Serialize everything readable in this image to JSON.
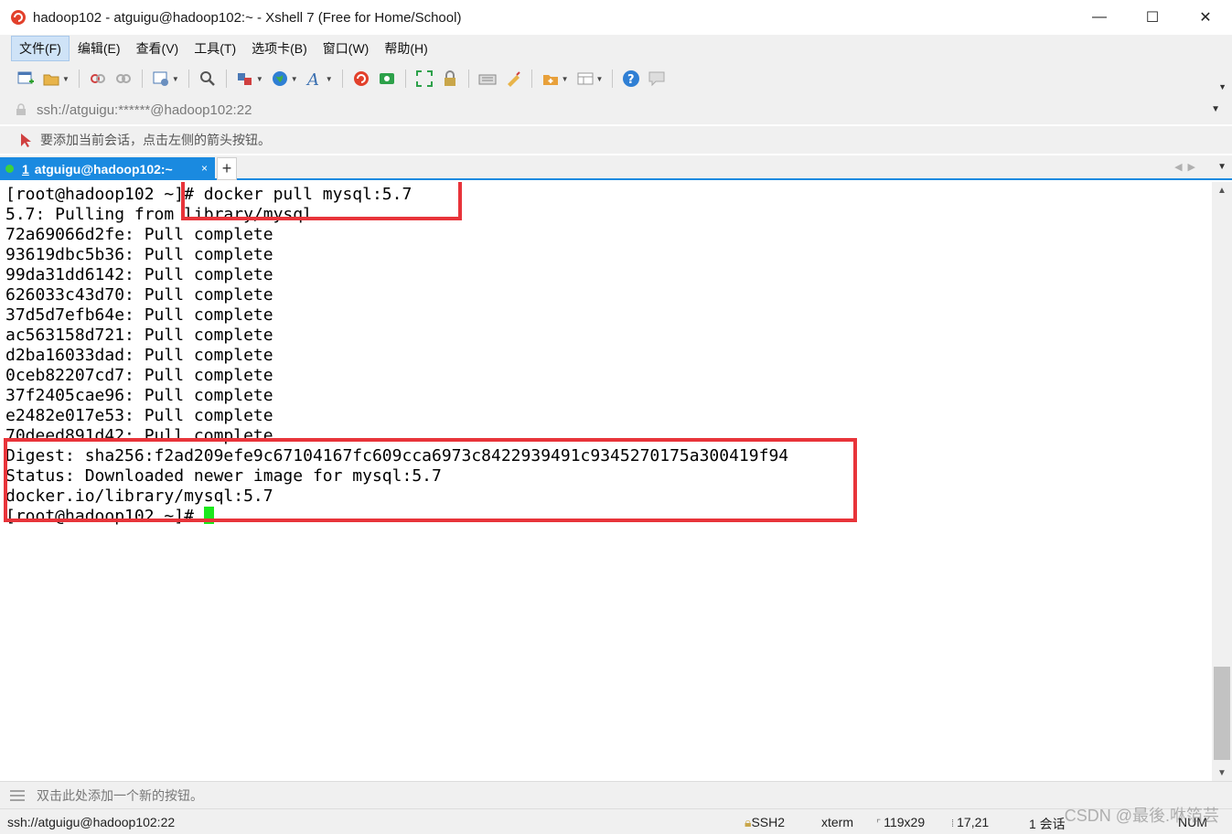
{
  "window": {
    "title": "hadoop102 - atguigu@hadoop102:~ - Xshell 7 (Free for Home/School)",
    "minimize": "—",
    "maximize": "☐",
    "close": "✕"
  },
  "menu": [
    {
      "label": "文件(F)"
    },
    {
      "label": "编辑(E)"
    },
    {
      "label": "查看(V)"
    },
    {
      "label": "工具(T)"
    },
    {
      "label": "选项卡(B)"
    },
    {
      "label": "窗口(W)"
    },
    {
      "label": "帮助(H)"
    }
  ],
  "toolbar": {
    "icons": [
      "new-session-icon",
      "open-folder-icon",
      "disconnect-icon",
      "reconnect-icon",
      "properties-icon",
      "find-icon",
      "transfer-icon",
      "globe-icon",
      "font-icon",
      "xshell-icon",
      "xftp-icon",
      "fullscreen-icon",
      "lock-icon",
      "keyboard-icon",
      "highlight-icon",
      "session-folder-icon",
      "layout-icon",
      "help-icon",
      "chat-icon"
    ]
  },
  "address": {
    "value": "ssh://atguigu:******@hadoop102:22"
  },
  "hint": {
    "text": "要添加当前会话，点击左侧的箭头按钮。"
  },
  "tab": {
    "number": "1",
    "label": "atguigu@hadoop102:~",
    "close": "×",
    "add": "+"
  },
  "terminal": {
    "lines": [
      "[root@hadoop102 ~]# docker pull mysql:5.7",
      "5.7: Pulling from library/mysql",
      "72a69066d2fe: Pull complete",
      "93619dbc5b36: Pull complete",
      "99da31dd6142: Pull complete",
      "626033c43d70: Pull complete",
      "37d5d7efb64e: Pull complete",
      "ac563158d721: Pull complete",
      "d2ba16033dad: Pull complete",
      "0ceb82207cd7: Pull complete",
      "37f2405cae96: Pull complete",
      "e2482e017e53: Pull complete",
      "70deed891d42: Pull complete",
      "Digest: sha256:f2ad209efe9c67104167fc609cca6973c8422939491c9345270175a300419f94",
      "Status: Downloaded newer image for mysql:5.7",
      "docker.io/library/mysql:5.7",
      "[root@hadoop102 ~]# "
    ]
  },
  "quickbar": {
    "text": "双击此处添加一个新的按钮。"
  },
  "status": {
    "connection": "ssh://atguigu@hadoop102:22",
    "protocol": "SSH2",
    "terminal_type": "xterm",
    "size": "119x29",
    "cursor_pos": "17,21",
    "sessions": "1 会话",
    "num": "NUM"
  },
  "watermark": "CSDN @最後.咻箔芸"
}
